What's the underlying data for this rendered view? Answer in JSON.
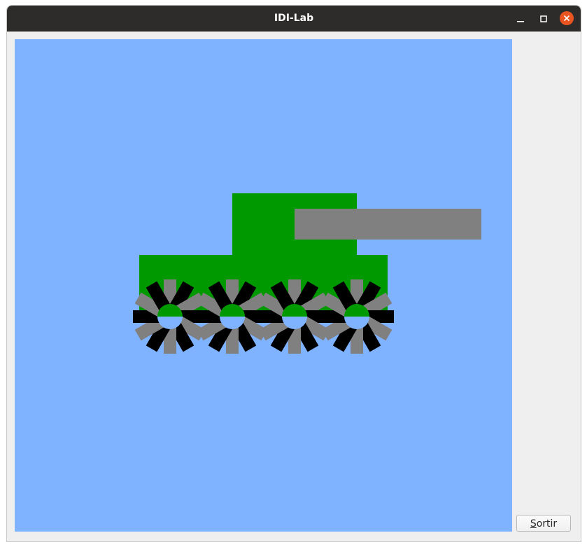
{
  "window": {
    "title": "IDI-Lab"
  },
  "controls": {
    "minimize_icon": "minimize-icon",
    "maximize_icon": "maximize-icon",
    "close_icon": "close-icon"
  },
  "scene": {
    "background_color": "#80b3ff",
    "body_color": "#009900",
    "cannon_color": "#808080",
    "wheel_spoke_colors": [
      "#000000",
      "#808080"
    ],
    "wheel_count": 4
  },
  "button": {
    "sortir_mnemonic": "S",
    "sortir_rest": "ortir"
  }
}
